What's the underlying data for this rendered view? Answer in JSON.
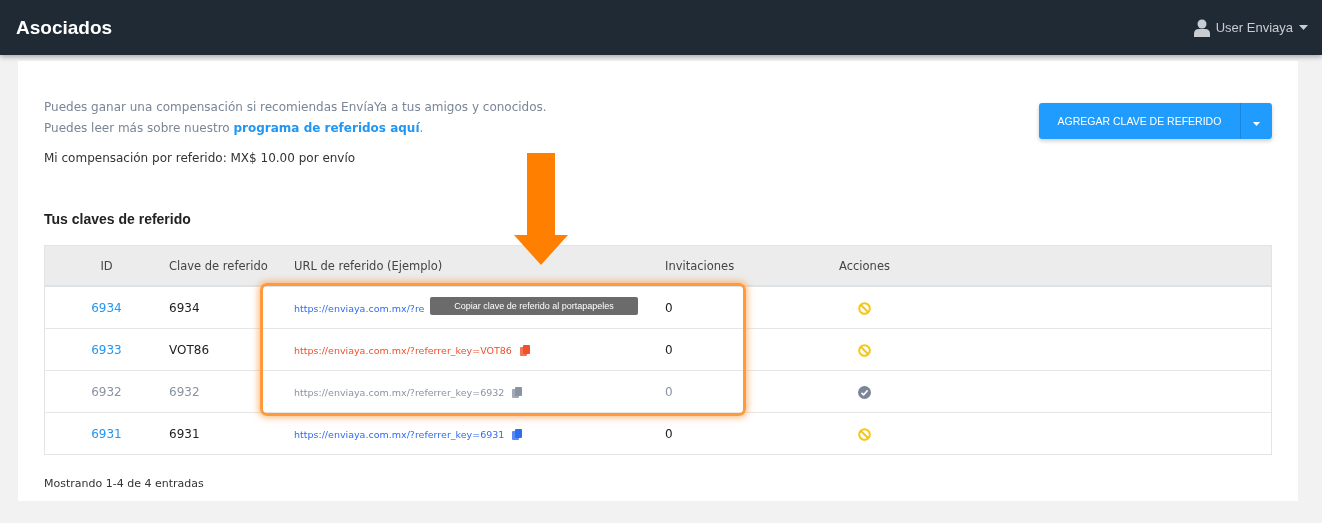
{
  "header": {
    "title": "Asociados",
    "user": "User Enviaya"
  },
  "intro": {
    "line1": "Puedes ganar una compensación si recomiendas EnvíaYa a tus amigos y conocidos.",
    "line2_before": "Puedes leer más sobre nuestro ",
    "line2_link": "programa de referidos aquí",
    "line2_after": ".",
    "compensation": "Mi compensación por referido: MX$ 10.00 por envío"
  },
  "add_button": {
    "label": "AGREGAR CLAVE DE REFERIDO"
  },
  "section_title": "Tus claves de referido",
  "table": {
    "columns": [
      "ID",
      "Clave de referido",
      "URL de referido (Ejemplo)",
      "Invitaciones",
      "Acciones"
    ],
    "rows": [
      {
        "id": "6934",
        "key": "6934",
        "url": "https://enviaya.com.mx/?re",
        "copy_icon": false,
        "invitations": "0",
        "active": true,
        "hovered": false
      },
      {
        "id": "6933",
        "key": "VOT86",
        "url": "https://enviaya.com.mx/?referrer_key=VOT86",
        "copy_icon": true,
        "invitations": "0",
        "active": true,
        "hovered": true
      },
      {
        "id": "6932",
        "key": "6932",
        "url": "https://enviaya.com.mx/?referrer_key=6932",
        "copy_icon": true,
        "invitations": "0",
        "active": false,
        "hovered": false
      },
      {
        "id": "6931",
        "key": "6931",
        "url": "https://enviaya.com.mx/?referrer_key=6931",
        "copy_icon": true,
        "invitations": "0",
        "active": true,
        "hovered": false
      }
    ]
  },
  "tooltip": "Copiar clave de referido al portapapeles",
  "footer": "Mostrando 1-4 de 4 entradas"
}
